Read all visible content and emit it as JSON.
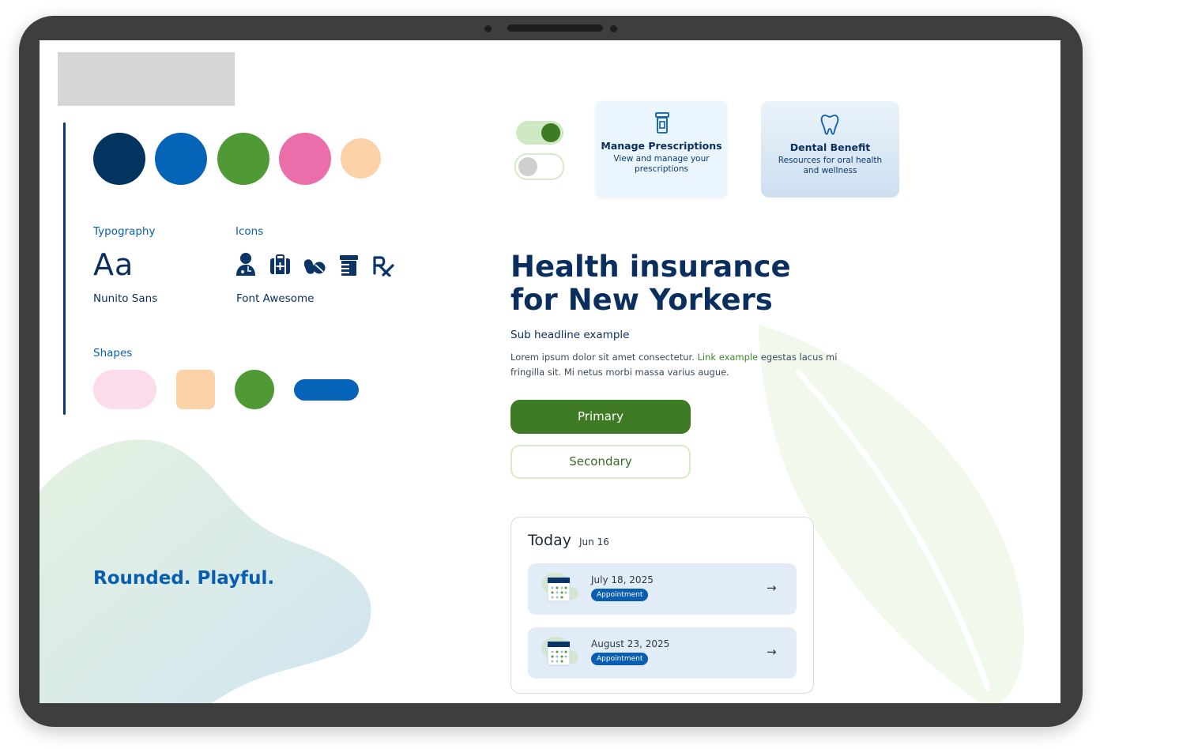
{
  "colors": {
    "navy": "#03335f",
    "blue": "#0563b8",
    "green": "#4f9a35",
    "pink": "#ea6ea9",
    "peach": "#fbd1a8",
    "button_primary": "#3f7a25",
    "light_green_border": "#d5ebc9"
  },
  "style_guide": {
    "typography_label": "Typography",
    "typography_sample": "Aa",
    "typography_font": "Nunito Sans",
    "icons_label": "Icons",
    "icons_source": "Font Awesome",
    "icons": [
      "user-doctor-icon",
      "medical-kit-icon",
      "pills-icon",
      "prescription-bottle-icon",
      "prescription-icon"
    ],
    "shapes_label": "Shapes",
    "tagline": "Rounded. Playful."
  },
  "cards": [
    {
      "icon": "prescription-bottle-icon",
      "title": "Manage Prescriptions",
      "subtitle": "View and manage your prescriptions"
    },
    {
      "icon": "tooth-icon",
      "title": "Dental Benefit",
      "subtitle": "Resources for oral health and wellness"
    }
  ],
  "hero": {
    "headline": "Health insurance for New Yorkers",
    "subheadline": "Sub headline example",
    "body_before": "Lorem ipsum dolor sit amet consectetur. ",
    "link": "Link example",
    "body_after": " egestas lacus mi fringilla sit. Mi netus morbi massa varius augue.",
    "primary_button": "Primary",
    "secondary_button": "Secondary"
  },
  "toggles": [
    {
      "state": "on"
    },
    {
      "state": "off"
    }
  ],
  "today": {
    "title": "Today",
    "date": "Jun 16",
    "appointments": [
      {
        "date": "July 18, 2025",
        "tag": "Appointment",
        "icon": "calendar-icon"
      },
      {
        "date": "August 23, 2025",
        "tag": "Appointment",
        "icon": "calendar-icon"
      }
    ]
  }
}
